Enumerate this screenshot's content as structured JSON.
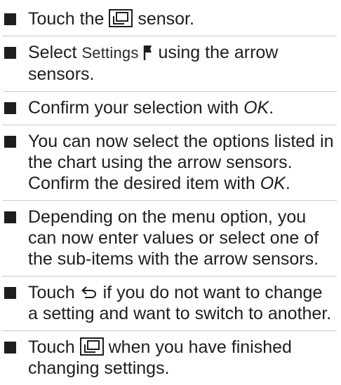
{
  "steps": [
    {
      "pre": "Touch the",
      "icon": "menu-sensor-icon",
      "post": "sensor."
    },
    {
      "pre": "Select",
      "menu_word": "Settings",
      "icon": "flag-icon",
      "post": "using the arrow sensors."
    },
    {
      "pre": "Confirm your selection with",
      "ok": "OK",
      "post": "."
    },
    {
      "pre": "You can now select the options listed in the chart using the arrow sensors. Confirm the desired item with",
      "ok": "OK",
      "post": "."
    },
    {
      "text": "Depending on the menu option, you can now enter values or select one of the sub-items with the arrow sensors."
    },
    {
      "pre": "Touch",
      "icon": "back-arrow-icon",
      "post": "if you do not want to change a setting and want to switch to another."
    },
    {
      "pre": "Touch",
      "icon": "menu-sensor-icon",
      "post": "when you have finished changing settings."
    }
  ]
}
